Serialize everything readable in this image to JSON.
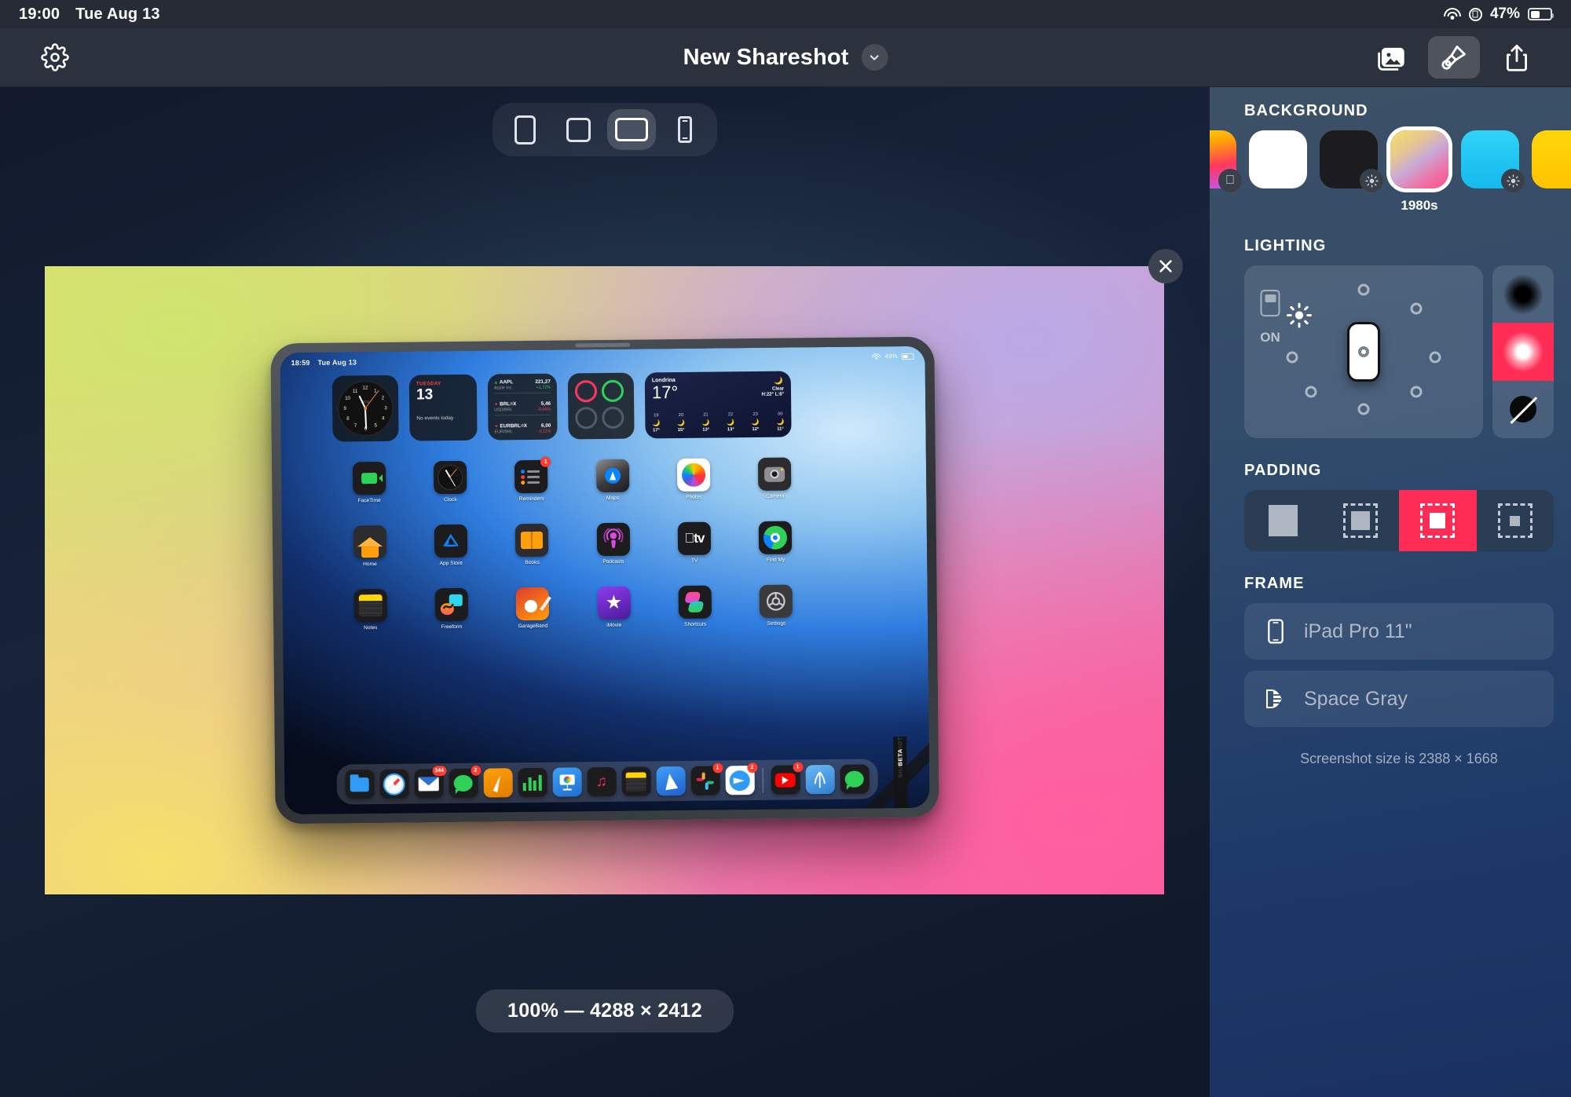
{
  "status_bar": {
    "time": "19:00",
    "date": "Tue Aug 13",
    "battery_percent": "47%",
    "icons": [
      "wifi-icon",
      "rotation-lock-icon",
      "battery-icon"
    ]
  },
  "toolbar": {
    "settings_icon": "gear-icon",
    "title": "New Shareshot",
    "title_chevron": "chevron-down-icon",
    "buttons": [
      {
        "name": "photos-library-button",
        "icon": "photos-icon",
        "active": false
      },
      {
        "name": "style-button",
        "icon": "paintbrush-icon",
        "active": true
      },
      {
        "name": "share-button",
        "icon": "share-icon",
        "active": false
      }
    ]
  },
  "canvas": {
    "aspect_ratios": [
      {
        "name": "portrait",
        "selected": false
      },
      {
        "name": "square",
        "selected": false
      },
      {
        "name": "landscape",
        "selected": true
      },
      {
        "name": "phone",
        "selected": false
      }
    ],
    "close_label": "×",
    "zoom_pill": "100% — 4288 × 2412"
  },
  "preview": {
    "device_screen": {
      "status_time": "18:59",
      "status_date": "Tue Aug 13",
      "status_battery": "49%",
      "widgets": {
        "clock": {
          "brand": "BCA",
          "numbers": [
            "12",
            "1",
            "2",
            "3",
            "4",
            "5",
            "6",
            "7",
            "8",
            "9",
            "10",
            "11"
          ]
        },
        "calendar": {
          "weekday": "TUESDAY",
          "day": "13",
          "events": "No events today"
        },
        "stocks": [
          {
            "symbol": "AAPL",
            "name": "Apple Inc.",
            "price": "221,27",
            "change": "+1,72%",
            "direction": "up"
          },
          {
            "symbol": "BRL=X",
            "name": "USD/BRL",
            "price": "5,46",
            "change": "-0,66%",
            "direction": "down"
          },
          {
            "symbol": "EURBRL=X",
            "name": "EUR/BRL",
            "price": "6,00",
            "change": "-0,11%",
            "direction": "down"
          }
        ],
        "weather": {
          "city": "Londrina",
          "temp": "17°",
          "condition": "Clear",
          "high_low": "H:22° L:6°",
          "hours": [
            {
              "hour": "19",
              "temp": "17°"
            },
            {
              "hour": "20",
              "temp": "15°"
            },
            {
              "hour": "21",
              "temp": "13°"
            },
            {
              "hour": "22",
              "temp": "13°"
            },
            {
              "hour": "23",
              "temp": "12°"
            },
            {
              "hour": "00",
              "temp": "11°"
            }
          ]
        }
      },
      "apps": [
        {
          "label": "FaceTime",
          "icon": "facetime-icon",
          "badge": ""
        },
        {
          "label": "Clock",
          "icon": "clock-icon",
          "badge": ""
        },
        {
          "label": "Reminders",
          "icon": "reminders-icon",
          "badge": "1"
        },
        {
          "label": "Maps",
          "icon": "maps-icon",
          "badge": ""
        },
        {
          "label": "Photos",
          "icon": "photos-icon",
          "badge": ""
        },
        {
          "label": "Camera",
          "icon": "camera-icon",
          "badge": ""
        },
        {
          "label": "Home",
          "icon": "home-icon",
          "badge": ""
        },
        {
          "label": "App Store",
          "icon": "app-store-icon",
          "badge": ""
        },
        {
          "label": "Books",
          "icon": "books-icon",
          "badge": ""
        },
        {
          "label": "Podcasts",
          "icon": "podcasts-icon",
          "badge": ""
        },
        {
          "label": "TV",
          "icon": "tv-icon",
          "badge": ""
        },
        {
          "label": "Find My",
          "icon": "find-my-icon",
          "badge": ""
        },
        {
          "label": "Notes",
          "icon": "notes-icon",
          "badge": ""
        },
        {
          "label": "Freeform",
          "icon": "freeform-icon",
          "badge": ""
        },
        {
          "label": "GarageBand",
          "icon": "garageband-icon",
          "badge": ""
        },
        {
          "label": "iMovie",
          "icon": "imovie-icon",
          "badge": ""
        },
        {
          "label": "Shortcuts",
          "icon": "shortcuts-icon",
          "badge": ""
        },
        {
          "label": "Settings",
          "icon": "settings-icon",
          "badge": ""
        }
      ],
      "dock": [
        {
          "name": "files-icon",
          "badge": ""
        },
        {
          "name": "safari-icon",
          "badge": ""
        },
        {
          "name": "mail-icon",
          "badge": "344"
        },
        {
          "name": "messages-icon",
          "badge": "2"
        },
        {
          "name": "pages-icon",
          "badge": ""
        },
        {
          "name": "numbers-icon",
          "badge": ""
        },
        {
          "name": "keynote-icon",
          "badge": ""
        },
        {
          "name": "music-icon",
          "badge": ""
        },
        {
          "name": "notes-icon",
          "badge": ""
        },
        {
          "name": "spark-icon",
          "badge": ""
        },
        {
          "name": "slack-icon",
          "badge": "1"
        },
        {
          "name": "telegram-icon",
          "badge": "2"
        },
        {
          "name": "youtube-icon",
          "badge": "1"
        },
        {
          "name": "drafts-icon",
          "badge": ""
        },
        {
          "name": "whatsapp-icon",
          "badge": ""
        }
      ],
      "ribbon_line1": "SHARESHOT",
      "ribbon_line2": "BETA"
    }
  },
  "sidebar": {
    "background": {
      "title": "BACKGROUND",
      "swatches": [
        {
          "name": "apple-gradient",
          "badge": "apple-icon",
          "label": "",
          "selected": false
        },
        {
          "name": "white",
          "badge": "",
          "label": "",
          "selected": false
        },
        {
          "name": "black",
          "badge": "brightness-icon",
          "label": "",
          "selected": false
        },
        {
          "name": "1980s",
          "badge": "",
          "label": "1980s",
          "selected": true
        },
        {
          "name": "cyan",
          "badge": "brightness-icon",
          "label": "",
          "selected": false
        },
        {
          "name": "yellow",
          "badge": "brightness-icon",
          "label": "",
          "selected": false
        }
      ]
    },
    "lighting": {
      "title": "LIGHTING",
      "toggle_label": "ON",
      "sun_icon": "brightness-icon",
      "options": [
        {
          "name": "shadow-option",
          "selected": false
        },
        {
          "name": "glow-option",
          "selected": true
        },
        {
          "name": "no-lighting-option",
          "selected": false
        }
      ]
    },
    "padding": {
      "title": "PADDING",
      "options": [
        {
          "name": "padding-none",
          "selected": false
        },
        {
          "name": "padding-small",
          "selected": false
        },
        {
          "name": "padding-medium",
          "selected": true
        },
        {
          "name": "padding-large",
          "selected": false
        }
      ]
    },
    "frame": {
      "title": "FRAME",
      "device": "iPad Pro 11\"",
      "device_icon": "device-icon",
      "color": "Space Gray",
      "color_icon": "color-palette-icon",
      "screenshot_size": "Screenshot size is 2388 × 1668"
    }
  },
  "colors": {
    "accent": "#ff2d55",
    "toolbar_bg": "#2b313d",
    "statusbar_bg": "#262b36"
  }
}
